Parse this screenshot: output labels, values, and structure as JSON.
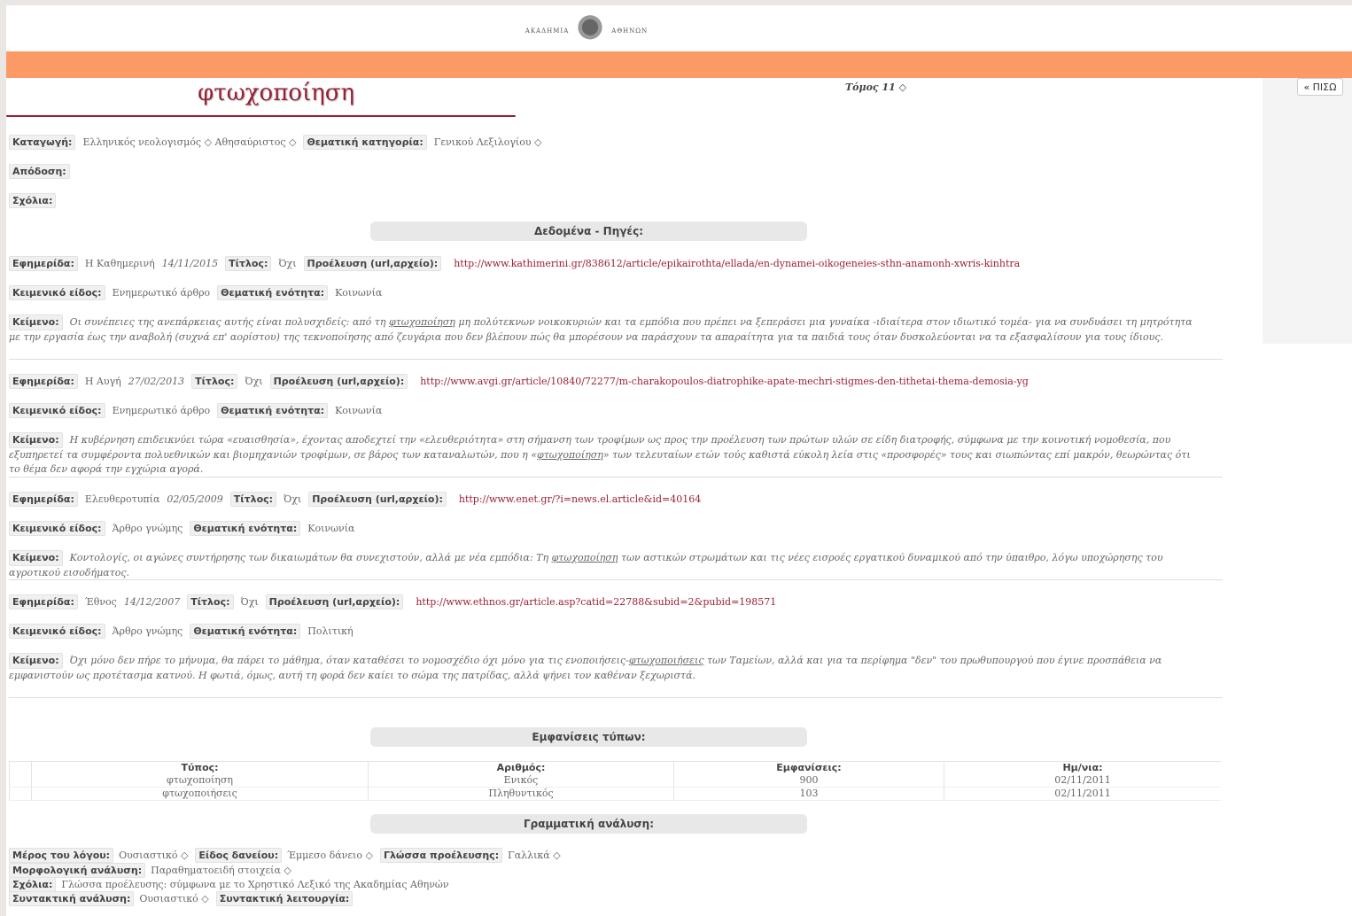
{
  "header": {
    "logo_left": "ΑΚΑΔΗΜΙΑ",
    "logo_right": "ΑΘΗΝΩΝ",
    "back_label": "« ΠΙΣΩ",
    "volume": "Τόμος 11 ◇",
    "colors": {
      "accent_orange": "#fc9a65",
      "title_red": "#9a1f35"
    }
  },
  "entry": {
    "title": "φτωχοποίηση",
    "katagogi_label": "Καταγωγή:",
    "katagogi_value": "Ελληνικός νεολογισμός ◇ Αθησαύριστος ◇",
    "thematiki_label": "Θεματική κατηγορία:",
    "thematiki_value": "Γενικού Λεξιλογίου ◇",
    "apodosi_label": "Απόδοση:",
    "scholia_label": "Σχόλια:"
  },
  "sources_header": "Δεδομένα - Πηγές:",
  "sources": [
    {
      "newspaper_label": "Εφημερίδα:",
      "newspaper": "Η Καθημερινή",
      "date": "14/11/2015",
      "title_label": "Τίτλος:",
      "title": "Όχι",
      "origin_label": "Προέλευση (url,αρχείο):",
      "url": "http://www.kathimerini.gr/838612/article/epikairothta/ellada/en-dynamei-oikogeneies-sthn-anamonh-xwris-kinhtra",
      "genre_label": "Κειμενικό είδος:",
      "genre": "Ενημερωτικό άρθρο",
      "unit_label": "Θεματική ενότητα:",
      "unit": "Κοινωνία",
      "text_label": "Κείμενο:",
      "text_before": "Οι συνέπειες της ανεπάρκειας αυτής είναι πολυσχιδείς: από τη ",
      "text_term": "φτωχοποίηση",
      "text_after": " μη πολύτεκνων νοικοκυριών και τα εμπόδια που πρέπει να ξεπεράσει μια γυναίκα -ιδιαίτερα στον ιδιωτικό τομέα- για να συνδυάσει τη μητρότητα με την εργασία έως την αναβολή (συχνά επ' αορίστου) της τεκνοποίησης από ζευγάρια που δεν βλέπουν πώς θα μπορέσουν να παράσχουν τα απαραίτητα για τα παιδιά τους όταν δυσκολεύονται να τα εξασφαλίσουν για τους ίδιους."
    },
    {
      "newspaper_label": "Εφημερίδα:",
      "newspaper": "Η Αυγή",
      "date": "27/02/2013",
      "title_label": "Τίτλος:",
      "title": "Όχι",
      "origin_label": "Προέλευση (url,αρχείο):",
      "url": "http://www.avgi.gr/article/10840/72277/m-charakopoulos-diatrophike-apate-mechri-stigmes-den-tithetai-thema-demosia-yg",
      "genre_label": "Κειμενικό είδος:",
      "genre": "Ενημερωτικό άρθρο",
      "unit_label": "Θεματική ενότητα:",
      "unit": "Κοινωνία",
      "text_label": "Κείμενο:",
      "text_before": "Η κυβέρνηση επιδεικνύει τώρα «ευαισθησία», έχοντας αποδεχτεί την «ελευθεριότητα» στη σήμανση των τροφίμων ως προς την προέλευση των πρώτων υλών σε είδη διατροφής, σύμφωνα με την κοινοτική νομοθεσία, που εξυπηρετεί τα συμφέροντα πολυεθνικών και βιομηχανιών τροφίμων, σε βάρος των καταναλωτών, που η «",
      "text_term": "φτωχοποίηση",
      "text_after": "» των τελευταίων ετών τούς καθιστά εύκολη λεία στις «προσφορές» τους και σιωπώντας επί μακρόν, θεωρώντας ότι το θέμα δεν αφορά την εγχώρια αγορά."
    },
    {
      "newspaper_label": "Εφημερίδα:",
      "newspaper": "Ελευθεροτυπία",
      "date": "02/05/2009",
      "title_label": "Τίτλος:",
      "title": "Όχι",
      "origin_label": "Προέλευση (url,αρχείο):",
      "url": "http://www.enet.gr/?i=news.el.article&id=40164",
      "genre_label": "Κειμενικό είδος:",
      "genre": "Άρθρο γνώμης",
      "unit_label": "Θεματική ενότητα:",
      "unit": "Κοινωνία",
      "text_label": "Κείμενο:",
      "text_before": "Κοντολογίς, οι αγώνες συντήρησης των δικαιωμάτων θα συνεχιστούν, αλλά με νέα εμπόδια: Τη ",
      "text_term": "φτωχοποίηση",
      "text_after": " των αστικών στρωμάτων και τις νέες εισροές εργατικού δυναμικού από την ύπαιθρο, λόγω υποχώρησης του αγροτικού εισοδήματος."
    },
    {
      "newspaper_label": "Εφημερίδα:",
      "newspaper": "Έθνος",
      "date": "14/12/2007",
      "title_label": "Τίτλος:",
      "title": "Όχι",
      "origin_label": "Προέλευση (url,αρχείο):",
      "url": "http://www.ethnos.gr/article.asp?catid=22788&subid=2&pubid=198571",
      "genre_label": "Κειμενικό είδος:",
      "genre": "Άρθρο γνώμης",
      "unit_label": "Θεματική ενότητα:",
      "unit": "Πολιτική",
      "text_label": "Κείμενο:",
      "text_before": "Όχι μόνο δεν πήρε το μήνυμα, θα πάρει το μάθημα, όταν καταθέσει το νομοσχέδιο όχι μόνο για τις ενοποιήσεις-",
      "text_term": "φτωχοποιήσεις",
      "text_after": " των Ταμείων, αλλά και για τα περίφημα \"δεν\" του πρωθυπουργού που έγινε προσπάθεια να εμφανιστούν ως προτέτασμα κατνού. Η φωτιά, όμως, αυτή τη φορά δεν καίει το σώμα της πατρίδας, αλλά ψήνει τον καθέναν ξεχωριστά."
    }
  ],
  "types_header": "Εμφανίσεις τύπων:",
  "types_table": {
    "columns": [
      "Τύπος:",
      "Αριθμός:",
      "Εμφανίσεις:",
      "Ημ/νια:"
    ],
    "rows": [
      [
        "φτωχοποίηση",
        "Ενικός",
        "900",
        "02/11/2011"
      ],
      [
        "φτωχοποιήσεις",
        "Πληθυντικός",
        "103",
        "02/11/2011"
      ]
    ]
  },
  "grammar_header": "Γραμματική ανάλυση:",
  "grammar": {
    "pos_label": "Μέρος του λόγου:",
    "pos": "Ουσιαστικό ◇",
    "loan_label": "Είδος δανείου:",
    "loan": "Έμμεσο δάνειο ◇",
    "lang_label": "Γλώσσα προέλευσης:",
    "lang": "Γαλλικά ◇",
    "morph_label": "Μορφολογική ανάλυση:",
    "morph": "Παραθηματοειδή στοιχεία ◇",
    "note_label": "Σχόλια:",
    "note": "Γλώσσα προέλευσης: σύμφωνα με το Χρηστικό Λεξικό της Ακαδημίας Αθηνών",
    "syntax_label": "Συντακτική ανάλυση:",
    "syntax": "Ουσιαστικό ◇",
    "function_label": "Συντακτική λειτουργία:"
  }
}
